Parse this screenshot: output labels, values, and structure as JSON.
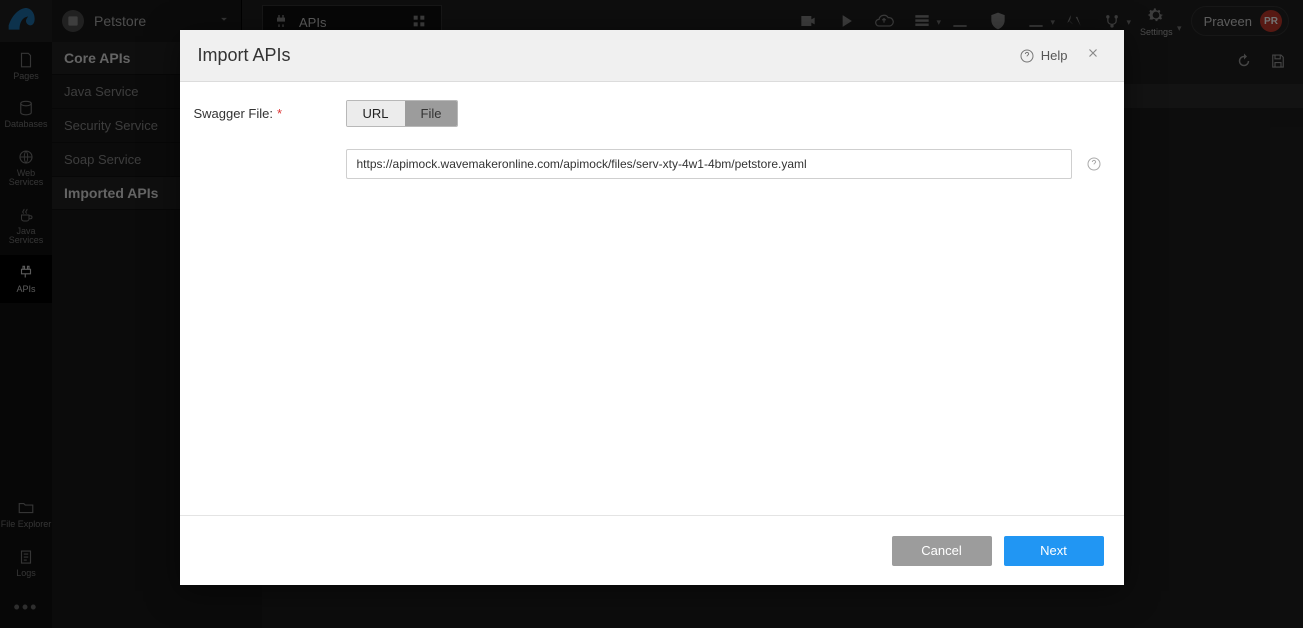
{
  "top": {
    "project_name": "Petstore",
    "tab_label": "APIs",
    "user_name": "Praveen",
    "user_initials": "PR",
    "settings_label": "Settings"
  },
  "rail": {
    "items": [
      {
        "key": "pages",
        "label": "Pages"
      },
      {
        "key": "databases",
        "label": "Databases"
      },
      {
        "key": "webservices",
        "label": "Web Services"
      },
      {
        "key": "javaservices",
        "label": "Java Services"
      },
      {
        "key": "apis",
        "label": "APIs"
      }
    ],
    "bottom": [
      {
        "key": "fileexplorer",
        "label": "File Explorer"
      },
      {
        "key": "logs",
        "label": "Logs"
      }
    ]
  },
  "sidepanel": {
    "section1": "Core APIs",
    "items": [
      "Java Service",
      "Security Service",
      "Soap Service"
    ],
    "section2": "Imported APIs"
  },
  "modal": {
    "title": "Import APIs",
    "help": "Help",
    "swagger_label": "Swagger File:",
    "toggle_url": "URL",
    "toggle_file": "File",
    "url_value": "https://apimock.wavemakeronline.com/apimock/files/serv-xty-4w1-4bm/petstore.yaml",
    "cancel": "Cancel",
    "next": "Next"
  }
}
